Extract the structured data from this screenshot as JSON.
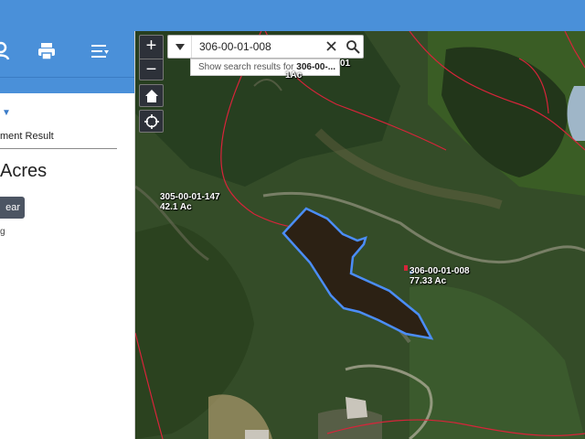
{
  "left_panel": {
    "result_label": "ment Result",
    "acres_title": "Acres",
    "clear_button": "ear",
    "small_text": "g",
    "colors": {
      "header_blue": "#4a90d9",
      "button_dark": "#4c5563"
    },
    "toolbar_icons": [
      "person-icon",
      "print-icon",
      "list-icon"
    ]
  },
  "map": {
    "search": {
      "value": "306-00-01-008",
      "suggestion_prefix": "Show search results for ",
      "suggestion_bold": "306-00-..."
    },
    "controls": {
      "zoom_in_label": "+",
      "zoom_out_label": "−",
      "home_icon": "home-icon",
      "locate_icon": "locate-icon"
    },
    "parcels": [
      {
        "id": "305-00-01-147",
        "acreage": "42.1 Ac"
      },
      {
        "id": "306-00-01-008",
        "acreage": "77.33 Ac"
      }
    ],
    "partial_labels": [
      "01",
      "1Ac"
    ],
    "colors": {
      "parcel_line": "#d8243a",
      "selection": "#4b8df8",
      "water": "#2c2114"
    }
  }
}
